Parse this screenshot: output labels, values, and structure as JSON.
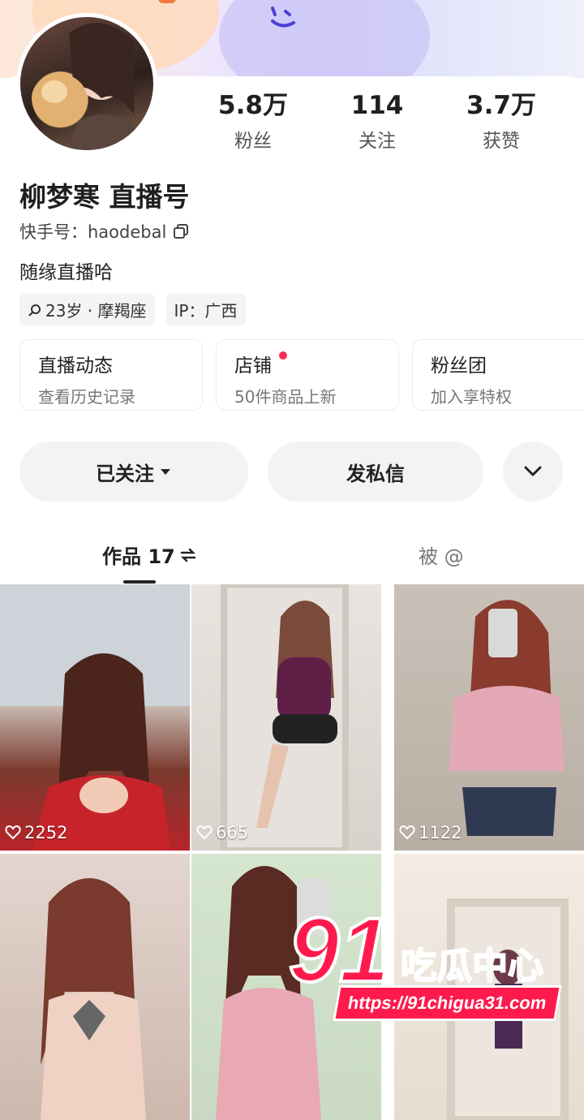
{
  "profile": {
    "stats": [
      {
        "value": "5.8万",
        "label": "粉丝"
      },
      {
        "value": "114",
        "label": "关注"
      },
      {
        "value": "3.7万",
        "label": "获赞"
      }
    ],
    "name": "柳梦寒 直播号",
    "uid": "快手号：haodebal",
    "bio": "随缘直播哈",
    "tags": [
      "23岁 · 摩羯座",
      "IP：广西"
    ]
  },
  "cards": [
    {
      "title": "直播动态",
      "subtitle": "查看历史记录",
      "dot": false
    },
    {
      "title": "店铺",
      "subtitle": "50件商品上新",
      "dot": true
    },
    {
      "title": "粉丝团",
      "subtitle": "加入享特权",
      "dot": false
    }
  ],
  "actions": {
    "follow": "已关注",
    "message": "发私信"
  },
  "tabs": {
    "works": "作品 17",
    "mentions": "被 @"
  },
  "grid": [
    {
      "likes": "2252"
    },
    {
      "likes": "665"
    },
    {
      "likes": "1122"
    },
    {
      "likes": ""
    },
    {
      "likes": ""
    },
    {
      "likes": ""
    }
  ],
  "watermark": {
    "number": "91",
    "text": "吃瓜中心",
    "url": "https://91chigua31.com"
  },
  "colors": {
    "accent": "#ff2c55",
    "watermark": "#ff1a4d"
  }
}
